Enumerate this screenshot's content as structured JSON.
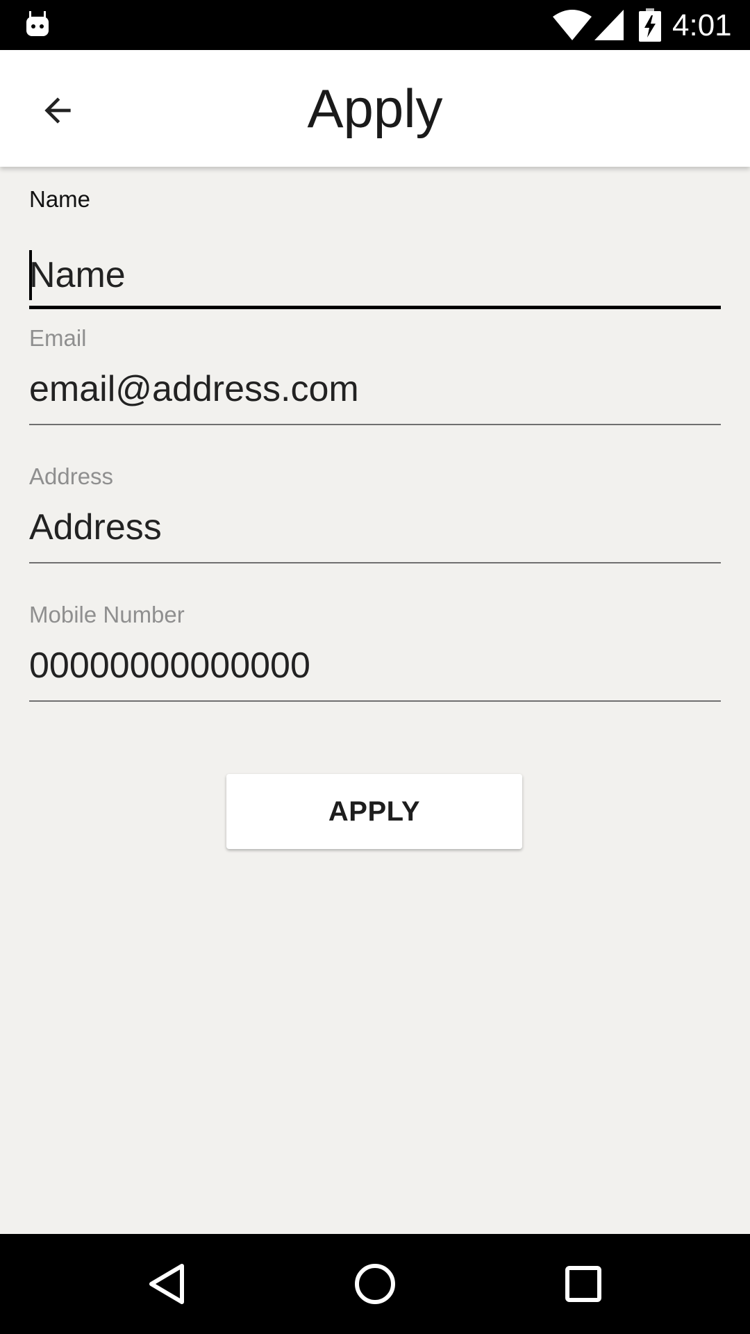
{
  "status_bar": {
    "time": "4:01",
    "icons": [
      "android-icon",
      "wifi-icon",
      "signal-icon",
      "battery-charging-icon"
    ]
  },
  "app_bar": {
    "title": "Apply",
    "back_icon": "arrow-back-icon"
  },
  "form": {
    "name": {
      "label": "Name",
      "placeholder": "Name",
      "value": ""
    },
    "email": {
      "label": "Email",
      "placeholder": "email@address.com",
      "value": ""
    },
    "address": {
      "label": "Address",
      "placeholder": "Address",
      "value": ""
    },
    "mobile": {
      "label": "Mobile Number",
      "placeholder": "00000000000000",
      "value": ""
    }
  },
  "apply_button": {
    "label": "APPLY"
  },
  "nav_bar": {
    "icons": [
      "back-triangle-icon",
      "home-circle-icon",
      "recents-square-icon"
    ]
  },
  "colors": {
    "background": "#f2f1ee",
    "app_bar": "#ffffff",
    "status_bar": "#000000",
    "label_inactive": "#8f8f8f",
    "label_active": "#111111"
  }
}
